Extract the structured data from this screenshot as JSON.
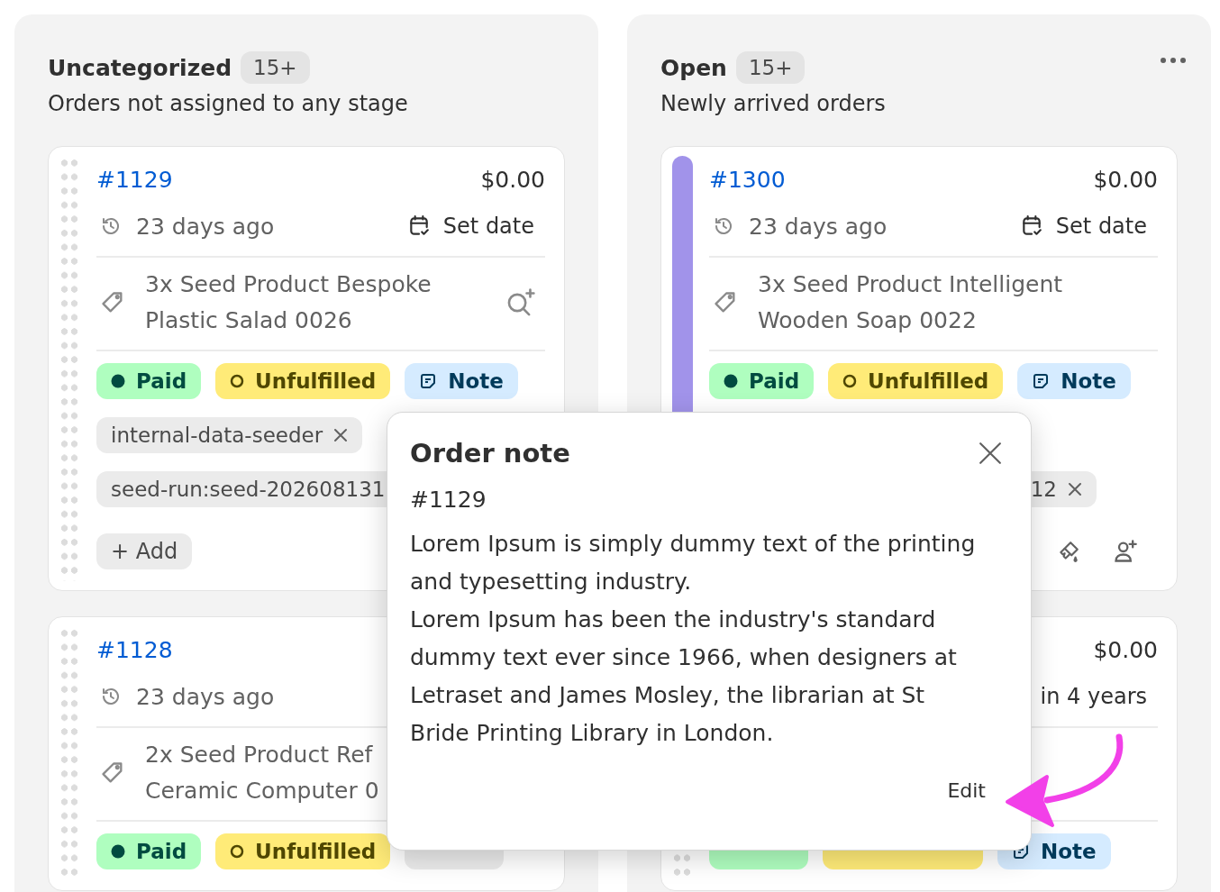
{
  "columns": [
    {
      "title": "Uncategorized",
      "count": "15+",
      "subtitle": "Orders not assigned to any stage",
      "menu": false,
      "cards": [
        {
          "number": "#1129",
          "amount": "$0.00",
          "age": "23 days ago",
          "date_action": {
            "kind": "set",
            "label": "Set date"
          },
          "product": [
            "3x Seed Product Bespoke",
            "Plastic Salad 0026"
          ],
          "product_search": true,
          "badges": [
            {
              "kind": "paid",
              "label": "Paid"
            },
            {
              "kind": "unfulfilled",
              "label": "Unfulfilled"
            },
            {
              "kind": "note",
              "label": "Note"
            }
          ],
          "tags_partly_hidden": false,
          "tags": [
            {
              "label": "internal-data-seeder",
              "removable": true
            },
            {
              "label": "seed-run:seed-202608131",
              "removable": false
            }
          ],
          "footer": {
            "kind": "add",
            "label": "+ Add"
          }
        },
        {
          "number": "#1128",
          "age": "23 days ago",
          "product": [
            "2x Seed Product Ref",
            "Ceramic Computer 0"
          ],
          "product_search": false,
          "badges": [
            {
              "kind": "paid",
              "label": "Paid"
            },
            {
              "kind": "unfulfilled",
              "label": "Unfulfilled"
            },
            {
              "kind": "empty_note"
            }
          ]
        }
      ]
    },
    {
      "title": "Open",
      "count": "15+",
      "subtitle": "Newly arrived orders",
      "menu": true,
      "cards": [
        {
          "color": "#a193ea",
          "number": "#1300",
          "amount": "$0.00",
          "age": "23 days ago",
          "date_action": {
            "kind": "set",
            "label": "Set date"
          },
          "product": [
            "3x Seed Product Intelligent",
            "Wooden Soap 0022"
          ],
          "product_search": false,
          "badges": [
            {
              "kind": "paid",
              "label": "Paid"
            },
            {
              "kind": "unfulfilled",
              "label": "Unfulfilled"
            },
            {
              "kind": "note",
              "label": "Note"
            }
          ],
          "tags_partly_hidden": true,
          "tags": [
            {
              "label": "12",
              "removable": true
            }
          ],
          "footer": {
            "kind": "icons"
          }
        },
        {
          "amount": "$0.00",
          "date_action": {
            "kind": "due",
            "label": "in 4 years"
          },
          "badges": [
            {
              "kind": "paid"
            },
            {
              "kind": "unfulfilled"
            },
            {
              "kind": "note",
              "label": "Note"
            }
          ]
        }
      ]
    }
  ],
  "popup": {
    "title": "Order note",
    "order": "#1129",
    "paragraphs": [
      "Lorem Ipsum is simply dummy text of the printing and typesetting industry.",
      "Lorem Ipsum has been the industry's standard dummy text ever since 1966, when designers at Letraset and James Mosley, the librarian at St Bride Printing Library in London."
    ],
    "action": "Edit"
  }
}
